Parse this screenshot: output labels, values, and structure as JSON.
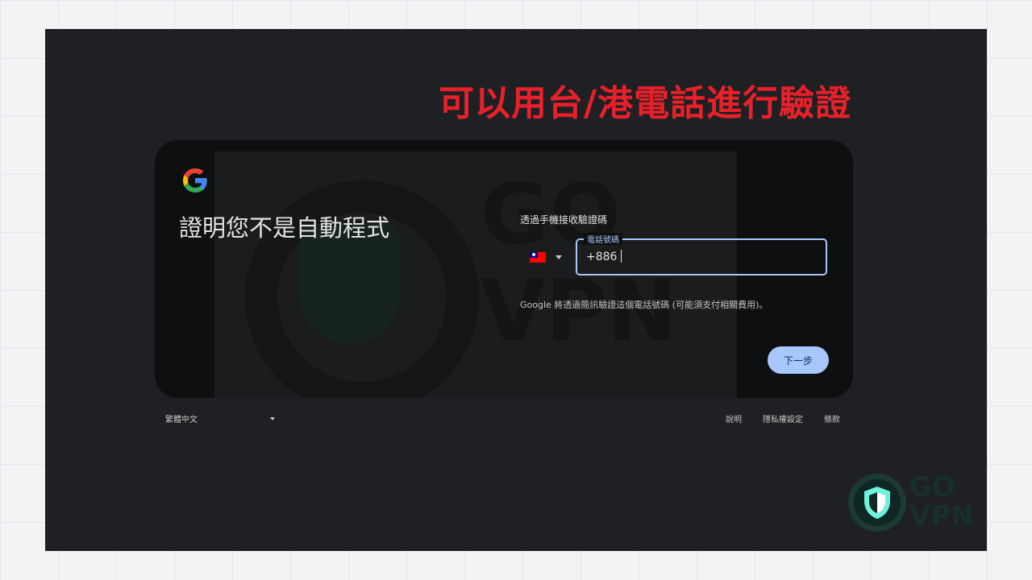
{
  "headline": "可以用台/港電話進行驗證",
  "watermark": {
    "line1": "GO",
    "line2": "VPN"
  },
  "card": {
    "title": "證明您不是自動程式",
    "subhead": "透過手機接收驗證碼",
    "phone_label": "電話號碼",
    "phone_value": "+886",
    "note": "Google 將透過簡訊驗證這個電話號碼 (可能須支付相關費用)。",
    "next_button": "下一步"
  },
  "footer": {
    "language": "繁體中文",
    "help": "說明",
    "privacy": "隱私權設定",
    "terms": "條款"
  },
  "brand": {
    "line1": "GO",
    "line2": "VPN"
  },
  "colors": {
    "accent": "#a8c7fa",
    "headline": "#e8202a",
    "card_bg": "#0e0f10",
    "frame_bg": "#1f2023"
  }
}
